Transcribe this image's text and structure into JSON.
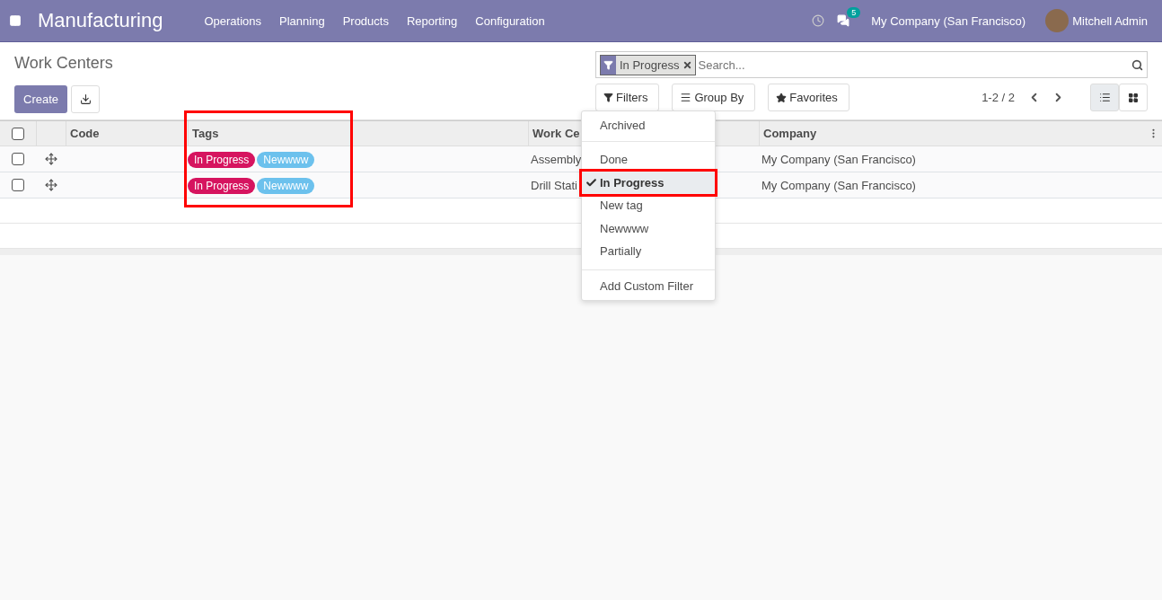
{
  "navbar": {
    "brand": "Manufacturing",
    "menu": [
      "Operations",
      "Planning",
      "Products",
      "Reporting",
      "Configuration"
    ],
    "message_count": "5",
    "company": "My Company (San Francisco)",
    "user": "Mitchell Admin"
  },
  "page": {
    "title": "Work Centers",
    "create": "Create"
  },
  "search": {
    "facets": [
      {
        "label": "In Progress"
      }
    ],
    "placeholder": "Search..."
  },
  "toolbar": {
    "filters": "Filters",
    "group_by": "Group By",
    "favorites": "Favorites",
    "pager": "1-2 / 2"
  },
  "views": [
    {
      "kind": "list",
      "selected": true
    },
    {
      "kind": "kanban",
      "selected": false
    }
  ],
  "table": {
    "all_checked": false,
    "columns": [
      {
        "label": "Code"
      },
      {
        "label": "Tags",
        "highlighted": true
      },
      {
        "label": "Work Ce"
      },
      {
        "label": "Company"
      }
    ],
    "rows": [
      {
        "checked": false,
        "tags": [
          {
            "label": "In Progress",
            "color": "#d6145f"
          },
          {
            "label": "Newwww",
            "color": "#6cc1ed"
          }
        ],
        "work_center": "Assembly",
        "company": "My Company (San Francisco)"
      },
      {
        "checked": false,
        "tags": [
          {
            "label": "In Progress",
            "color": "#d6145f"
          },
          {
            "label": "Newwww",
            "color": "#6cc1ed"
          }
        ],
        "work_center": "Drill Stati",
        "company": "My Company (San Francisco)"
      }
    ]
  },
  "filter_menu": {
    "groups": [
      [
        {
          "label": "Archived",
          "checked": false,
          "highlighted": false
        }
      ],
      [
        {
          "label": "Done",
          "checked": false,
          "highlighted": false
        },
        {
          "label": "In Progress",
          "checked": true,
          "highlighted": true
        },
        {
          "label": "New tag",
          "checked": false,
          "highlighted": false
        },
        {
          "label": "Newwww",
          "checked": false,
          "highlighted": false
        },
        {
          "label": "Partially",
          "checked": false,
          "highlighted": false
        }
      ],
      [
        {
          "label": "Add Custom Filter",
          "checked": false,
          "highlighted": false
        }
      ]
    ]
  }
}
